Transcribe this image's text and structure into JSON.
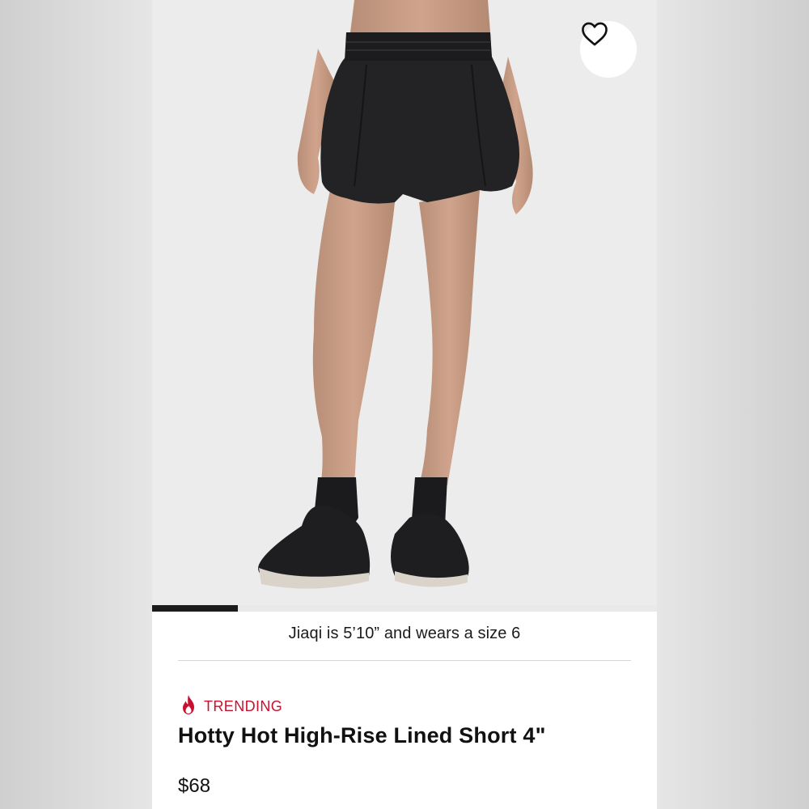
{
  "product": {
    "model_info": "Jiaqi is 5’10” and wears a size 6",
    "badge": "TRENDING",
    "title": "Hotty Hot High-Rise Lined Short 4\"",
    "price": "$68",
    "image_carousel_progress": 0.17
  },
  "icons": {
    "favorite": "heart-outline-icon",
    "trending": "flame-icon"
  },
  "colors": {
    "accent": "#c8102e",
    "text": "#111111",
    "image_background": "#ececec",
    "progress": "#1b1b1b"
  }
}
